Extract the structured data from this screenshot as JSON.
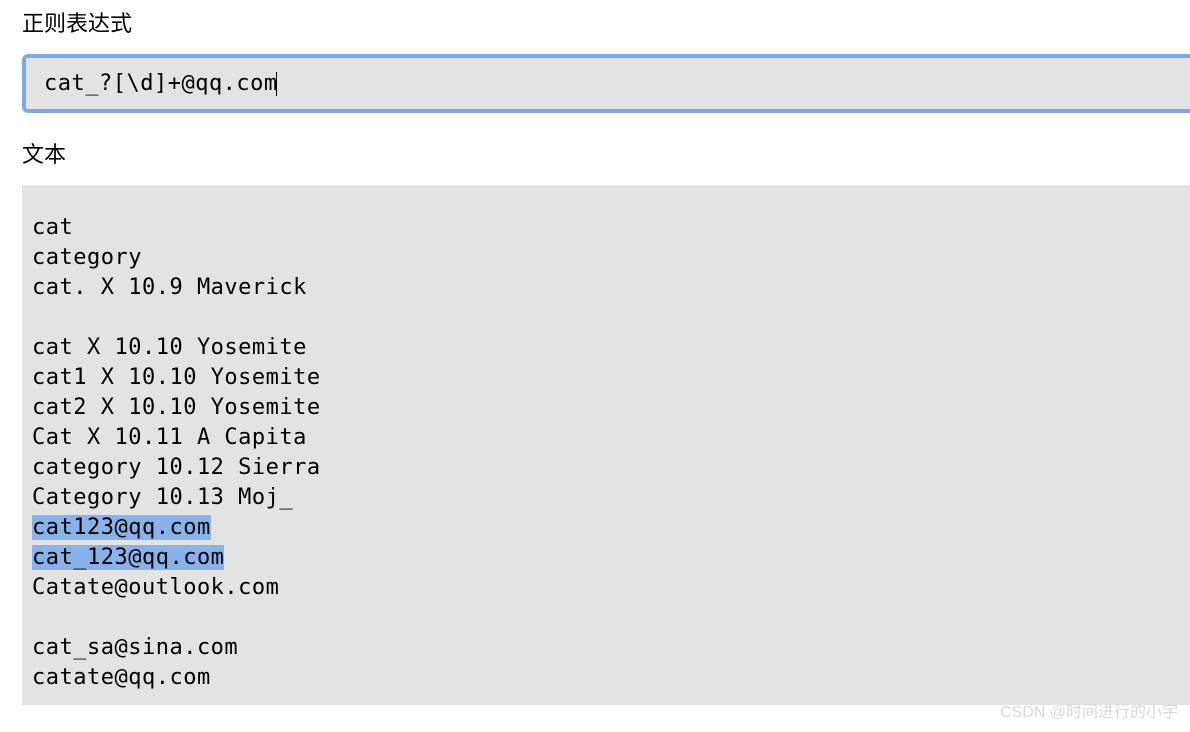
{
  "labels": {
    "regex": "正则表达式",
    "text": "文本"
  },
  "regex_value": "cat_?[\\d]+@qq.com",
  "text_lines": [
    {
      "text": "cat",
      "match": false
    },
    {
      "text": "category",
      "match": false
    },
    {
      "text": "cat. X 10.9 Maverick",
      "match": false
    },
    {
      "text": "",
      "match": false
    },
    {
      "text": "cat X 10.10 Yosemite",
      "match": false
    },
    {
      "text": "cat1 X 10.10 Yosemite",
      "match": false
    },
    {
      "text": "cat2 X 10.10 Yosemite",
      "match": false
    },
    {
      "text": "Cat X 10.11 A Capita",
      "match": false
    },
    {
      "text": "category 10.12 Sierra",
      "match": false
    },
    {
      "text": "Category 10.13 Moj_",
      "match": false
    },
    {
      "text": "cat123@qq.com",
      "match": true
    },
    {
      "text": "cat_123@qq.com",
      "match": true
    },
    {
      "text": "Catate@outlook.com",
      "match": false
    },
    {
      "text": "",
      "match": false
    },
    {
      "text": "cat_sa@sina.com",
      "match": false
    },
    {
      "text": "catate@qq.com",
      "match": false
    }
  ],
  "watermark": "CSDN @时间进行的小宇"
}
